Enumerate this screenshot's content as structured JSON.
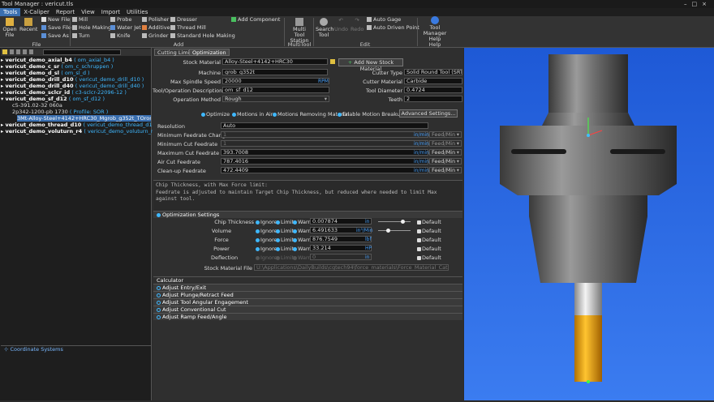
{
  "window": {
    "title": "Tool Manager : vericut.tls"
  },
  "menu": [
    "Tools",
    "X-Caliper",
    "Report",
    "View",
    "Import",
    "Utilities"
  ],
  "ribbon": {
    "file": {
      "open": "Open File",
      "recent": "Recent",
      "new": "New File",
      "save": "Save File",
      "saveas": "Save As",
      "group": "File"
    },
    "add": {
      "mill": "Mill",
      "probe": "Probe",
      "polisher": "Polisher",
      "dresser": "Dresser",
      "add_component": "Add Component",
      "hole_making": "Hole Making",
      "water_jet": "Water Jet",
      "additive": "Additive",
      "thread_mill": "Thread Mill",
      "turn": "Turn",
      "knife": "Knife",
      "grinder": "Grinder",
      "std_hole": "Standard Hole Making",
      "group": "Add"
    },
    "multitool": {
      "station": "Multi Tool Station",
      "group": "MultiTool"
    },
    "edit": {
      "search": "Search Tool",
      "undo": "Undo",
      "redo": "Redo",
      "auto_gage": "Auto Gage",
      "auto_driven": "Auto Driven Point",
      "group": "Edit"
    },
    "help": {
      "tm_help": "Tool Manager Help",
      "group": "Help"
    }
  },
  "tree": [
    {
      "name": "vericut_demo_axial_b4",
      "desc": "( om_axial_b4 )"
    },
    {
      "name": "vericut_demo_c_sr",
      "desc": "( om_c_schruppen )"
    },
    {
      "name": "vericut_demo_d_sl",
      "desc": "( om_sl_d )"
    },
    {
      "name": "vericut_demo_drill_d10",
      "desc": "( vericut_demo_drill_d10 )"
    },
    {
      "name": "vericut_demo_drill_d40",
      "desc": "( vericut_demo_drill_d40 )"
    },
    {
      "name": "vericut_demo_sclcr_id",
      "desc": "( c3-sclcr-22096-12 )"
    },
    {
      "name": "vericut_demo_sf_d12",
      "desc": "( om_sf_d12 )"
    },
    {
      "name": "c5-391.02-32 060a",
      "desc": ""
    },
    {
      "name": "2p342-1200-pb 1730",
      "desc": "( Profile: SOR )"
    },
    {
      "name": "3Mt-Alloy-Steel+4142+HRC30_Mgrob_g352t_TOrom",
      "desc": ""
    },
    {
      "name": "vericut_demo_thread_d10",
      "desc": "( vericut_demo_thread_d10 )"
    },
    {
      "name": "vericut_demo_voluturn_r4",
      "desc": "( vericut_demo_voluturn_r4 )"
    }
  ],
  "coordinate_systems": "Coordinate Systems",
  "tabs": [
    "Cutting Limits",
    "Optimization"
  ],
  "form": {
    "stock_material_label": "Stock Material",
    "stock_material": "Alloy-Steel+4142+HRC30",
    "add_stock_btn": "Add New Stock Material",
    "machine_label": "Machine",
    "machine": "grob_g352t",
    "max_spindle_label": "Max Spindle Speed",
    "max_spindle": "20000",
    "max_spindle_unit": "RPM",
    "desc_label": "Tool/Operation Description",
    "desc": "om_sf_d12",
    "op_method_label": "Operation Method",
    "op_method": "Rough",
    "cutter_type_label": "Cutter Type",
    "cutter_type": "Solid Round Tool (SRT)",
    "cutter_material_label": "Cutter Material",
    "cutter_material": "Carbide",
    "tool_diameter_label": "Tool Diameter",
    "tool_diameter": "0.4724",
    "teeth_label": "Teeth",
    "teeth": "2"
  },
  "checks": {
    "optimize": "Optimize",
    "motions_air": "Motions in Air",
    "motions_removing": "Motions Removing Material",
    "motion_breakup": "Enable Motion Breakup",
    "advanced": "Advanced Settings..."
  },
  "feeds": [
    {
      "label": "Resolution",
      "value": "Auto",
      "unit": "",
      "mode": ""
    },
    {
      "label": "Minimum Feedrate Change",
      "value": "1",
      "unit": "in/min",
      "mode": "Feed/Min"
    },
    {
      "label": "Minimum Cut Feedrate",
      "value": "1",
      "unit": "in/min",
      "mode": "Feed/Min"
    },
    {
      "label": "Maximum Cut Feedrate",
      "value": "393.7008",
      "unit": "in/min",
      "mode": "Feed/Min"
    },
    {
      "label": "Air Cut Feedrate",
      "value": "787.4016",
      "unit": "in/min",
      "mode": "Feed/Min"
    },
    {
      "label": "Clean-up Feedrate",
      "value": "472.4409",
      "unit": "in/min",
      "mode": "Feed/Min"
    }
  ],
  "message": "Chip Thickness, with Max Force limit:\nFeedrate is adjusted to maintain Target Chip Thickness, but reduced where needed to limit Max against tool.",
  "opt_settings": {
    "title": "Optimization Settings",
    "rows": [
      {
        "label": "Chip Thickness",
        "value": "0.007874",
        "unit": "in",
        "default": "Default"
      },
      {
        "label": "Volume",
        "value": "6.491633",
        "unit": "in³/Min",
        "default": "Default"
      },
      {
        "label": "Force",
        "value": "876.7549",
        "unit": "lbf",
        "default": "Default"
      },
      {
        "label": "Power",
        "value": "33.214",
        "unit": "HP",
        "default": "Default"
      },
      {
        "label": "Deflection",
        "value": "0",
        "unit": "in",
        "default": "Default"
      }
    ],
    "opts": [
      "Ignore",
      "Limit",
      "Warn"
    ],
    "stock_file_label": "Stock Material File",
    "stock_file": "U:\\Applications\\DailyBuilds\\cgtech94\\force_materials\\Force_Material_Catalog_v10"
  },
  "calculator": {
    "title": "Calculator",
    "items": [
      "Adjust Entry/Exit",
      "Adjust Plunge/Retract Feed",
      "Adjust Tool Angular Engagement",
      "Adjust Conventional Cut",
      "Adjust Ramp Feed/Angle"
    ]
  },
  "colors": {
    "accent": "#3fb8ff",
    "viewport": "#2a6ae8",
    "tool_tip": "#f0a800"
  }
}
